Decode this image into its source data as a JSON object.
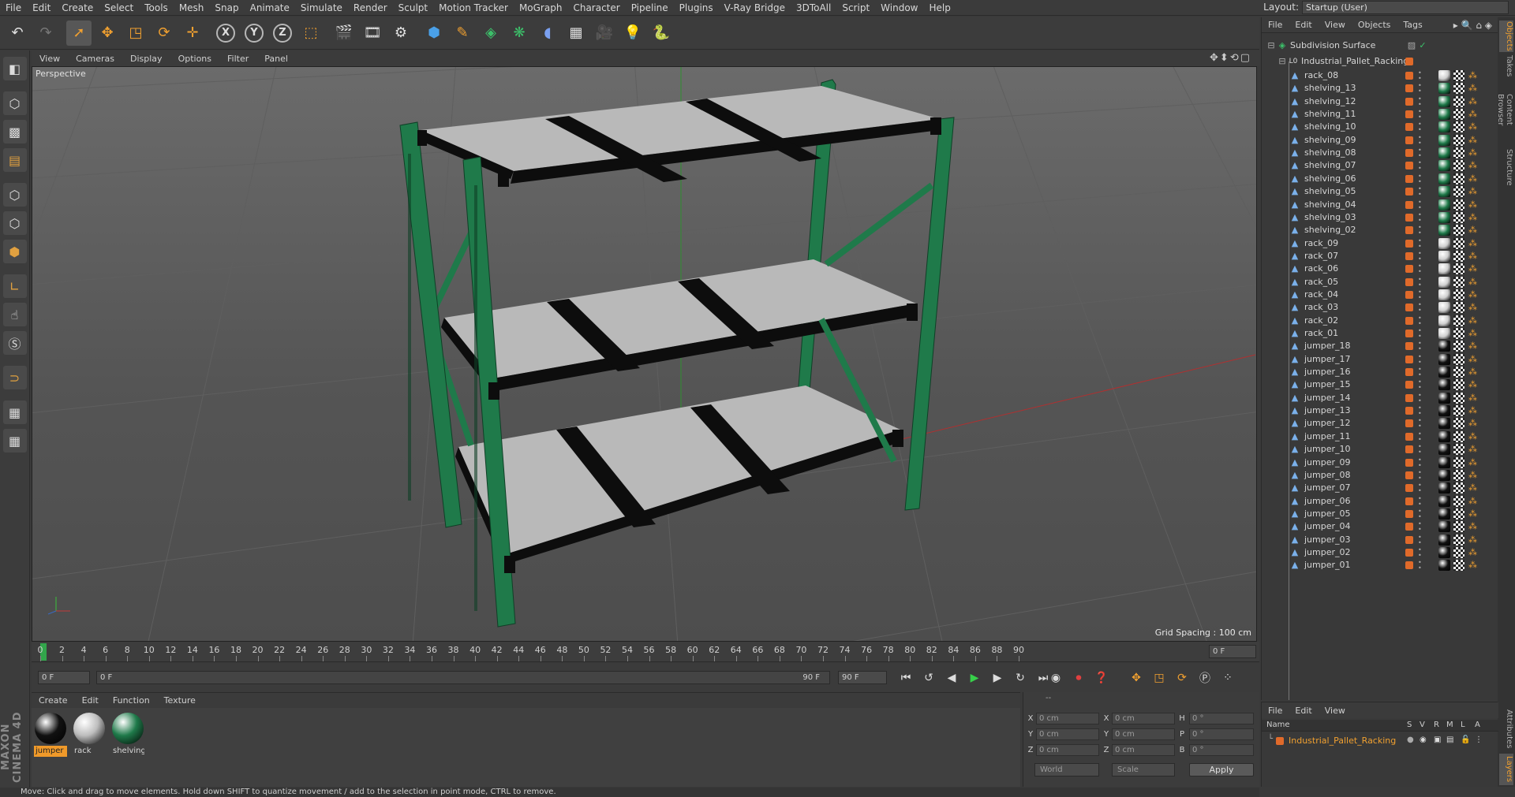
{
  "menubar": {
    "items": [
      "File",
      "Edit",
      "Create",
      "Select",
      "Tools",
      "Mesh",
      "Snap",
      "Animate",
      "Simulate",
      "Render",
      "Sculpt",
      "Motion Tracker",
      "MoGraph",
      "Character",
      "Pipeline",
      "Plugins",
      "V-Ray Bridge",
      "3DToAll",
      "Script",
      "Window",
      "Help"
    ],
    "layout_label": "Layout:",
    "layout_value": "Startup (User)"
  },
  "toolbar": {
    "axis_x": "X",
    "axis_y": "Y",
    "axis_z": "Z"
  },
  "viewport": {
    "menu": [
      "View",
      "Cameras",
      "Display",
      "Options",
      "Filter",
      "Panel"
    ],
    "label": "Perspective",
    "grid_spacing": "Grid Spacing : 100 cm"
  },
  "timeline": {
    "ticks": [
      "0",
      "2",
      "4",
      "6",
      "8",
      "10",
      "12",
      "14",
      "16",
      "18",
      "20",
      "22",
      "24",
      "26",
      "28",
      "30",
      "32",
      "34",
      "36",
      "38",
      "40",
      "42",
      "44",
      "46",
      "48",
      "50",
      "52",
      "54",
      "56",
      "58",
      "60",
      "62",
      "64",
      "66",
      "68",
      "70",
      "72",
      "74",
      "76",
      "78",
      "80",
      "82",
      "84",
      "86",
      "88",
      "90"
    ],
    "current_frame": "0 F"
  },
  "transport": {
    "start_field": "0 F",
    "range_left": "0 F",
    "range_right": "90 F",
    "end_field": "90 F"
  },
  "materials": {
    "menu": [
      "Create",
      "Edit",
      "Function",
      "Texture"
    ],
    "items": [
      {
        "name": "jumper",
        "selected": true,
        "color": "#111111"
      },
      {
        "name": "rack",
        "selected": false,
        "color": "#bdbdbd"
      },
      {
        "name": "shelving",
        "selected": false,
        "color": "#1f7a4a"
      }
    ]
  },
  "coordinates": {
    "header_dashes": "--",
    "x_pos": "0 cm",
    "y_pos": "0 cm",
    "z_pos": "0 cm",
    "x_size": "0 cm",
    "y_size": "0 cm",
    "z_size": "0 cm",
    "h_rot": "0 °",
    "p_rot": "0 °",
    "b_rot": "0 °",
    "label_x": "X",
    "label_y": "Y",
    "label_z": "Z",
    "label_h": "H",
    "label_p": "P",
    "label_b": "B",
    "mode_world": "World",
    "mode_scale": "Scale",
    "apply": "Apply"
  },
  "status": "Move: Click and drag to move elements. Hold down SHIFT to quantize movement / add to the selection in point mode, CTRL to remove.",
  "object_manager": {
    "menu": [
      "File",
      "Edit",
      "View",
      "Objects",
      "Tags"
    ],
    "root": "Subdivision Surface",
    "group": "Industrial_Pallet_Racking",
    "objects": [
      {
        "name": "rack_08",
        "mat": "rack"
      },
      {
        "name": "shelving_13",
        "mat": "shelving"
      },
      {
        "name": "shelving_12",
        "mat": "shelving"
      },
      {
        "name": "shelving_11",
        "mat": "shelving"
      },
      {
        "name": "shelving_10",
        "mat": "shelving"
      },
      {
        "name": "shelving_09",
        "mat": "shelving"
      },
      {
        "name": "shelving_08",
        "mat": "shelving"
      },
      {
        "name": "shelving_07",
        "mat": "shelving"
      },
      {
        "name": "shelving_06",
        "mat": "shelving"
      },
      {
        "name": "shelving_05",
        "mat": "shelving"
      },
      {
        "name": "shelving_04",
        "mat": "shelving"
      },
      {
        "name": "shelving_03",
        "mat": "shelving"
      },
      {
        "name": "shelving_02",
        "mat": "shelving"
      },
      {
        "name": "rack_09",
        "mat": "rack"
      },
      {
        "name": "rack_07",
        "mat": "rack"
      },
      {
        "name": "rack_06",
        "mat": "rack"
      },
      {
        "name": "rack_05",
        "mat": "rack"
      },
      {
        "name": "rack_04",
        "mat": "rack"
      },
      {
        "name": "rack_03",
        "mat": "rack"
      },
      {
        "name": "rack_02",
        "mat": "rack"
      },
      {
        "name": "rack_01",
        "mat": "rack"
      },
      {
        "name": "jumper_18",
        "mat": "jumper"
      },
      {
        "name": "jumper_17",
        "mat": "jumper"
      },
      {
        "name": "jumper_16",
        "mat": "jumper"
      },
      {
        "name": "jumper_15",
        "mat": "jumper"
      },
      {
        "name": "jumper_14",
        "mat": "jumper"
      },
      {
        "name": "jumper_13",
        "mat": "jumper"
      },
      {
        "name": "jumper_12",
        "mat": "jumper"
      },
      {
        "name": "jumper_11",
        "mat": "jumper"
      },
      {
        "name": "jumper_10",
        "mat": "jumper"
      },
      {
        "name": "jumper_09",
        "mat": "jumper"
      },
      {
        "name": "jumper_08",
        "mat": "jumper"
      },
      {
        "name": "jumper_07",
        "mat": "jumper"
      },
      {
        "name": "jumper_06",
        "mat": "jumper"
      },
      {
        "name": "jumper_05",
        "mat": "jumper"
      },
      {
        "name": "jumper_04",
        "mat": "jumper"
      },
      {
        "name": "jumper_03",
        "mat": "jumper"
      },
      {
        "name": "jumper_02",
        "mat": "jumper"
      },
      {
        "name": "jumper_01",
        "mat": "jumper"
      }
    ]
  },
  "side_tabs": [
    "Objects",
    "Takes",
    "Content Browser",
    "Structure"
  ],
  "side_tabs_lower": [
    "Attributes",
    "Layers"
  ],
  "layer_manager": {
    "menu": [
      "File",
      "Edit",
      "View"
    ],
    "columns": {
      "name": "Name",
      "s": "S",
      "v": "V",
      "r": "R",
      "m": "M",
      "l": "L",
      "a": "A"
    },
    "layer": "Industrial_Pallet_Racking"
  },
  "branding": "MAXON CINEMA 4D",
  "colors": {
    "accent": "#f09a2a",
    "shelving": "#1f7a4a",
    "layer": "#e06a2a"
  }
}
